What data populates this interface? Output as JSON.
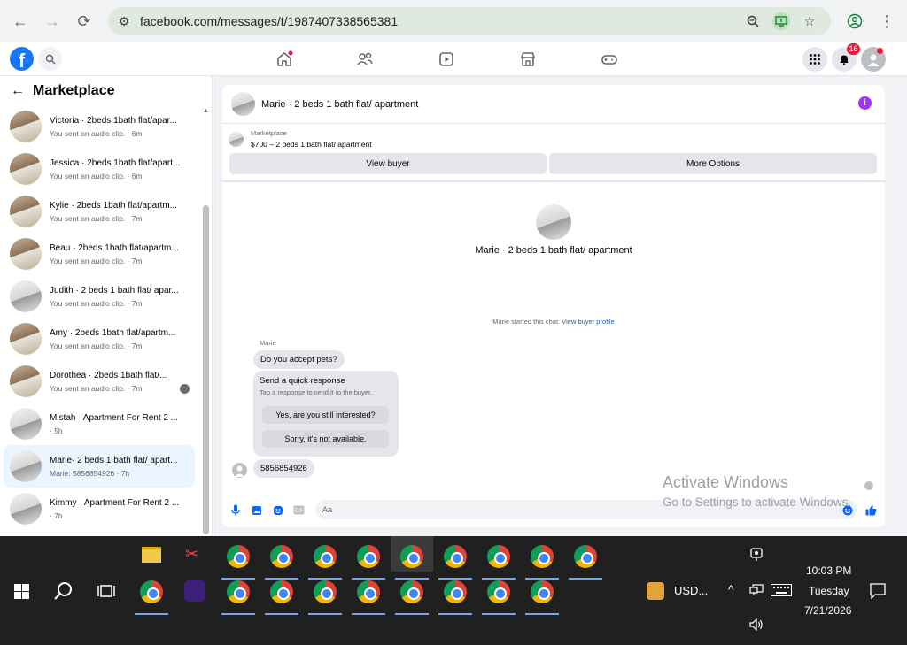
{
  "browser": {
    "url": "facebook.com/messages/t/1987407338565381"
  },
  "header": {
    "notifications_badge": "16"
  },
  "sidebar": {
    "title": "Marketplace",
    "threads": [
      {
        "title": "Victoria · 2beds 1bath flat/apar...",
        "subtitle": "You sent an audio clip. · 6m",
        "style": "warm"
      },
      {
        "title": "Jessica · 2beds 1bath flat/apart...",
        "subtitle": "You sent an audio clip. · 6m",
        "style": "warm"
      },
      {
        "title": "Kylie · 2beds 1bath flat/apartm...",
        "subtitle": "You sent an audio clip. · 7m",
        "style": "warm"
      },
      {
        "title": "Beau · 2beds 1bath flat/apartm...",
        "subtitle": "You sent an audio clip. · 7m",
        "style": "warm"
      },
      {
        "title": "Judith · 2 beds 1 bath flat/ apar...",
        "subtitle": "You sent an audio clip. · 7m",
        "style": "cool"
      },
      {
        "title": "Amy · 2beds 1bath flat/apartm...",
        "subtitle": "You sent an audio clip. · 7m",
        "style": "warm"
      },
      {
        "title": "Dorothea · 2beds 1bath flat/...",
        "subtitle": "You sent an audio clip. · 7m",
        "style": "warm"
      },
      {
        "title": "Mistah · Apartment For Rent 2 ...",
        "subtitle": "· 5h",
        "style": "cool"
      },
      {
        "title": "Marie· 2 beds 1 bath flat/ apart...",
        "subtitle": "Marie: 5856854926 · 7h",
        "style": "cool"
      },
      {
        "title": "Kimmy · Apartment For Rent 2 ...",
        "subtitle": "· 7h",
        "style": "cool"
      }
    ]
  },
  "chat": {
    "header_title": "Marie · 2 beds 1 bath flat/ apartment",
    "marketplace_label": "Marketplace",
    "listing_price": "$700 – 2 beds 1 bath flat/ apartment",
    "view_buyer": "View buyer",
    "more_options": "More Options",
    "center_name": "Marie · 2 beds 1 bath flat/ apartment",
    "started_text": "Marie started this chat.",
    "view_buyer_profile": "View buyer profile",
    "sender": "Marie",
    "message1": "Do you accept pets?",
    "quick_title": "Send a quick response",
    "quick_sub": "Tap a response to send it to the buyer.",
    "quick_option1": "Yes, are you still interested?",
    "quick_option2": "Sorry, it's not available.",
    "message2": "5856854926",
    "composer_placeholder": "Aa"
  },
  "watermark": {
    "line1": "Activate Windows",
    "line2": "Go to Settings to activate Windows."
  },
  "taskbar": {
    "stock": "USD...",
    "time": "10:03 PM",
    "day": "Tuesday",
    "date": "7/21/2026"
  }
}
